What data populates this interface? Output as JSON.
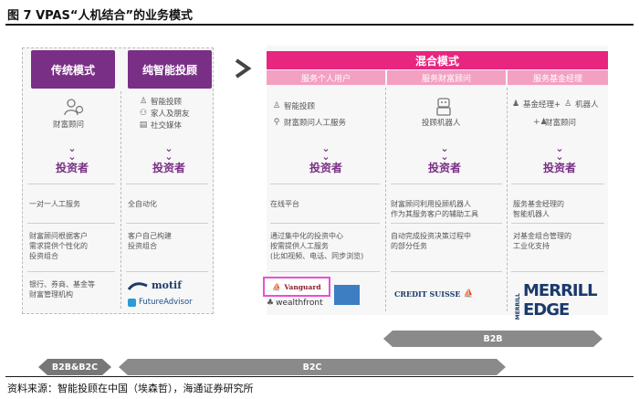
{
  "title": "图 7  VPAS“人机结合”的业务模式",
  "source": "资料来源：智能投顾在中国（埃森哲），海通证券研究所",
  "colors": {
    "purple": "#7a2f86",
    "pink": "#e8257f",
    "light_pink": "#f3a0c3",
    "gray": "#8a8a8a"
  },
  "left": {
    "traditional": {
      "header": "传统模式",
      "items": [
        {
          "icon": "advisor-icon",
          "label": "财富顾问"
        }
      ],
      "investor": "投资者",
      "service": "一对一人工服务",
      "desc": "财富顾问根据客户\n需求提供个性化的\n投资组合",
      "examples": "银行、券商、基金等\n财富管理机构"
    },
    "robo": {
      "header": "纯智能投顾",
      "items": [
        {
          "icon": "robot-icon",
          "label": "智能投顾"
        },
        {
          "icon": "family-icon",
          "label": "家人及朋友"
        },
        {
          "icon": "social-media-icon",
          "label": "社交媒体"
        }
      ],
      "investor": "投资者",
      "service": "全自动化",
      "desc": "客户自己构建\n投资组合",
      "logos": [
        "motif",
        "FutureAdvisor"
      ]
    }
  },
  "hybrid": {
    "header": "混合模式",
    "columns": [
      {
        "subheader": "服务个人用户",
        "items": [
          {
            "icon": "robot-icon",
            "label": "智能投顾"
          },
          {
            "icon": "advisor-icon",
            "label": "财富顾问人工服务"
          }
        ],
        "investor": "投资者",
        "service": "在线平台",
        "desc": "通过集中化的投资中心\n按需提供人工服务\n(比如视频、电话、同步浏览)",
        "logos": [
          "Vanguard",
          "wealthfront"
        ]
      },
      {
        "subheader": "服务财富顾问",
        "items": [
          {
            "icon": "robot-advisor-icon",
            "label": "投顾机器人"
          }
        ],
        "investor": "投资者",
        "service": "财富顾问利用投顾机器人\n作为其服务客户的辅助工具",
        "desc": "自动完成投资决策过程中\n的部分任务",
        "logos": [
          "CREDIT SUISSE"
        ]
      },
      {
        "subheader": "服务基金经理",
        "items": [
          {
            "icon": "fund-manager-icon",
            "label": "基金经理+"
          },
          {
            "icon": "robot-icon",
            "label": "机器人"
          },
          {
            "icon": "advisor-icon",
            "label": "财富顾问"
          }
        ],
        "investor": "投资者",
        "service": "服务基金经理的\n智能机器人",
        "desc": "对基金组合管理的\n工业化支持",
        "logos": [
          "MERRILL EDGE"
        ]
      }
    ]
  },
  "bars": {
    "b2b_b2c": "B2B&B2C",
    "b2c": "B2C",
    "b2b": "B2B"
  }
}
